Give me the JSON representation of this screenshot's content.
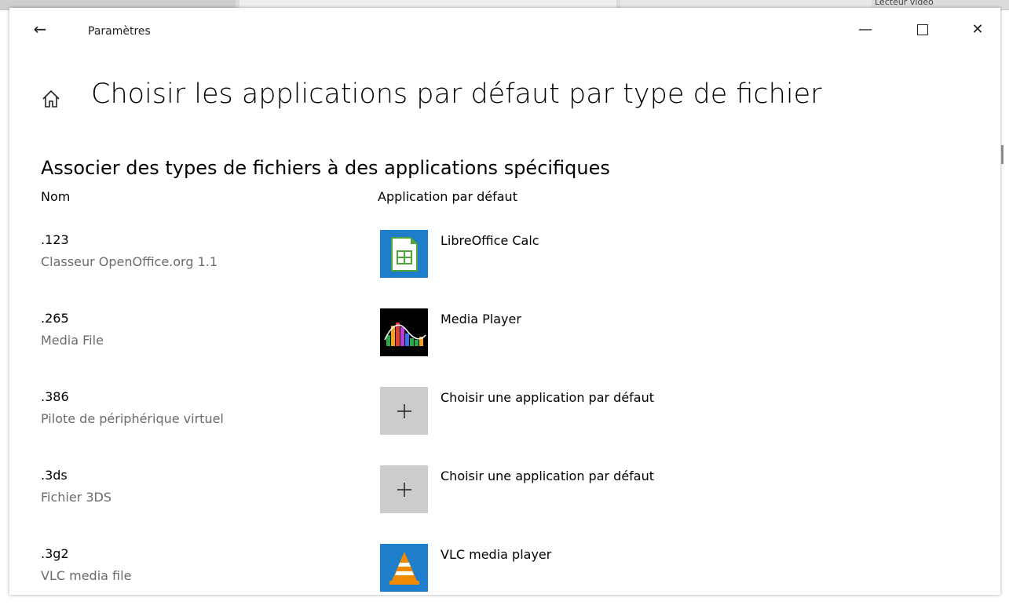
{
  "background": {
    "text": "Lecteur vidéo"
  },
  "window": {
    "title": "Paramètres",
    "back_label": "←",
    "minimize_label": "—",
    "close_label": "✕"
  },
  "page": {
    "title": "Choisir les applications par défaut par type de fichier",
    "section_title": "Associer des types de fichiers à des applications spécifiques",
    "col_name": "Nom",
    "col_app": "Application par défaut"
  },
  "rows": [
    {
      "ext": ".123",
      "desc": "Classeur OpenOffice.org 1.1",
      "app": "LibreOffice Calc",
      "icon": "libreoffice-calc-icon"
    },
    {
      "ext": ".265",
      "desc": "Media File",
      "app": "Media Player",
      "icon": "media-player-icon"
    },
    {
      "ext": ".386",
      "desc": "Pilote de périphérique virtuel",
      "app": "Choisir une application par défaut",
      "icon": "plus-icon"
    },
    {
      "ext": ".3ds",
      "desc": "Fichier 3DS",
      "app": "Choisir une application par défaut",
      "icon": "plus-icon"
    },
    {
      "ext": ".3g2",
      "desc": "VLC media file",
      "app": "VLC media player",
      "icon": "vlc-icon"
    }
  ],
  "colors": {
    "tile_blue": "#1f7ecc",
    "tile_grey": "#cccccc",
    "secondary_text": "#6b6b6b"
  }
}
